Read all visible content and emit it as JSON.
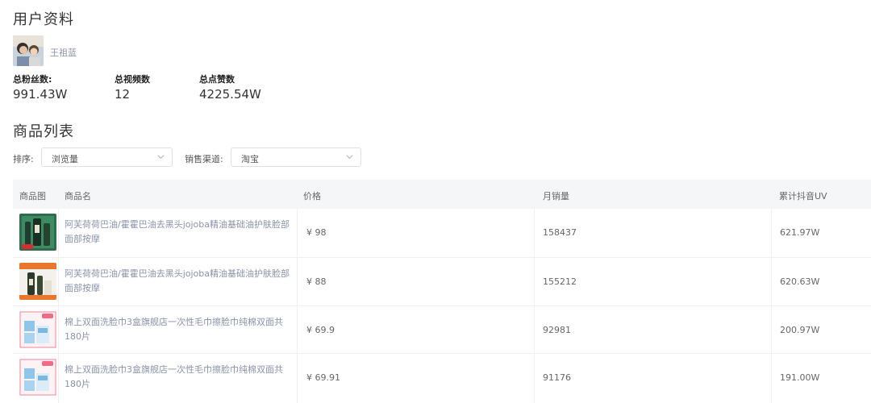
{
  "profile": {
    "heading": "用户资料",
    "user_name": "王祖蓝",
    "stats": [
      {
        "label": "总粉丝数:",
        "value": "991.43W"
      },
      {
        "label": "总视频数",
        "value": "12"
      },
      {
        "label": "总点赞数",
        "value": "4225.54W"
      }
    ]
  },
  "products": {
    "heading": "商品列表",
    "sort_label": "排序:",
    "sort_value": "浏览量",
    "channel_label": "销售渠道:",
    "channel_value": "淘宝",
    "columns": [
      "商品图",
      "商品名",
      "价格",
      "月销量",
      "累计抖音UV"
    ],
    "rows": [
      {
        "name": "阿芙荷荷巴油/霍霍巴油去黑头jojoba精油基础油护肤脸部面部按摩",
        "price": "¥ 98",
        "monthly_sales": "158437",
        "uv": "621.97W",
        "thumb": "green-bottle"
      },
      {
        "name": "阿芙荷荷巴油/霍霍巴油去黑头jojoba精油基础油护肤脸部面部按摩",
        "price": "¥ 88",
        "monthly_sales": "155212",
        "uv": "620.63W",
        "thumb": "orange-bottle"
      },
      {
        "name": "棉上双面洗脸巾3盒旗舰店一次性毛巾擦脸巾纯棉双面共180片",
        "price": "¥ 69.9",
        "monthly_sales": "92981",
        "uv": "200.97W",
        "thumb": "blue-box"
      },
      {
        "name": "棉上双面洗脸巾3盒旗舰店一次性毛巾擦脸巾纯棉双面共180片",
        "price": "¥ 69.91",
        "monthly_sales": "91176",
        "uv": "191.00W",
        "thumb": "blue-box"
      }
    ]
  },
  "colors": {
    "link_gray": "#8a93a8",
    "header_bg": "#f5f6f8",
    "border": "#dcdfe6"
  }
}
